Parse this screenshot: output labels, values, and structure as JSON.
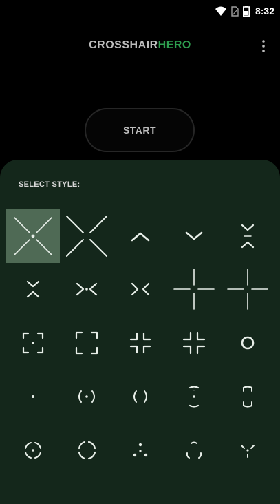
{
  "status_bar": {
    "time": "8:32",
    "icons": [
      "wifi-icon",
      "sim-icon",
      "battery-icon"
    ]
  },
  "header": {
    "title_part1": "CROSSHAIR",
    "title_part2": "HERO",
    "menu_icon": "more-vertical-icon"
  },
  "start_button": {
    "label": "START"
  },
  "style_panel": {
    "section_label": "SELECT STYLE:",
    "selected_index": 0,
    "styles": [
      "large-x-with-dot",
      "large-x",
      "chevron-up",
      "chevron-down",
      "double-chevron-vertical",
      "double-chevron-vertical-wide",
      "arrows-in-with-dot",
      "arrows-in",
      "plus-gap",
      "plus-gap-alt",
      "bracket-square-dot",
      "bracket-square",
      "corner-arrows-in",
      "corner-arrows-in-alt",
      "ring",
      "dot",
      "parens-dot",
      "parens",
      "vertical-brackets-dot",
      "vertical-brackets",
      "circle-dot-quartered",
      "circle-quartered",
      "triangle-dots",
      "triangle-dots-arcs",
      "triangle-dots-inverted"
    ]
  },
  "colors": {
    "background": "#000000",
    "panel": "#14271b",
    "selected_cell": "#4f6a55",
    "accent": "#2e9e4f",
    "glyph": "#e8efe9"
  }
}
